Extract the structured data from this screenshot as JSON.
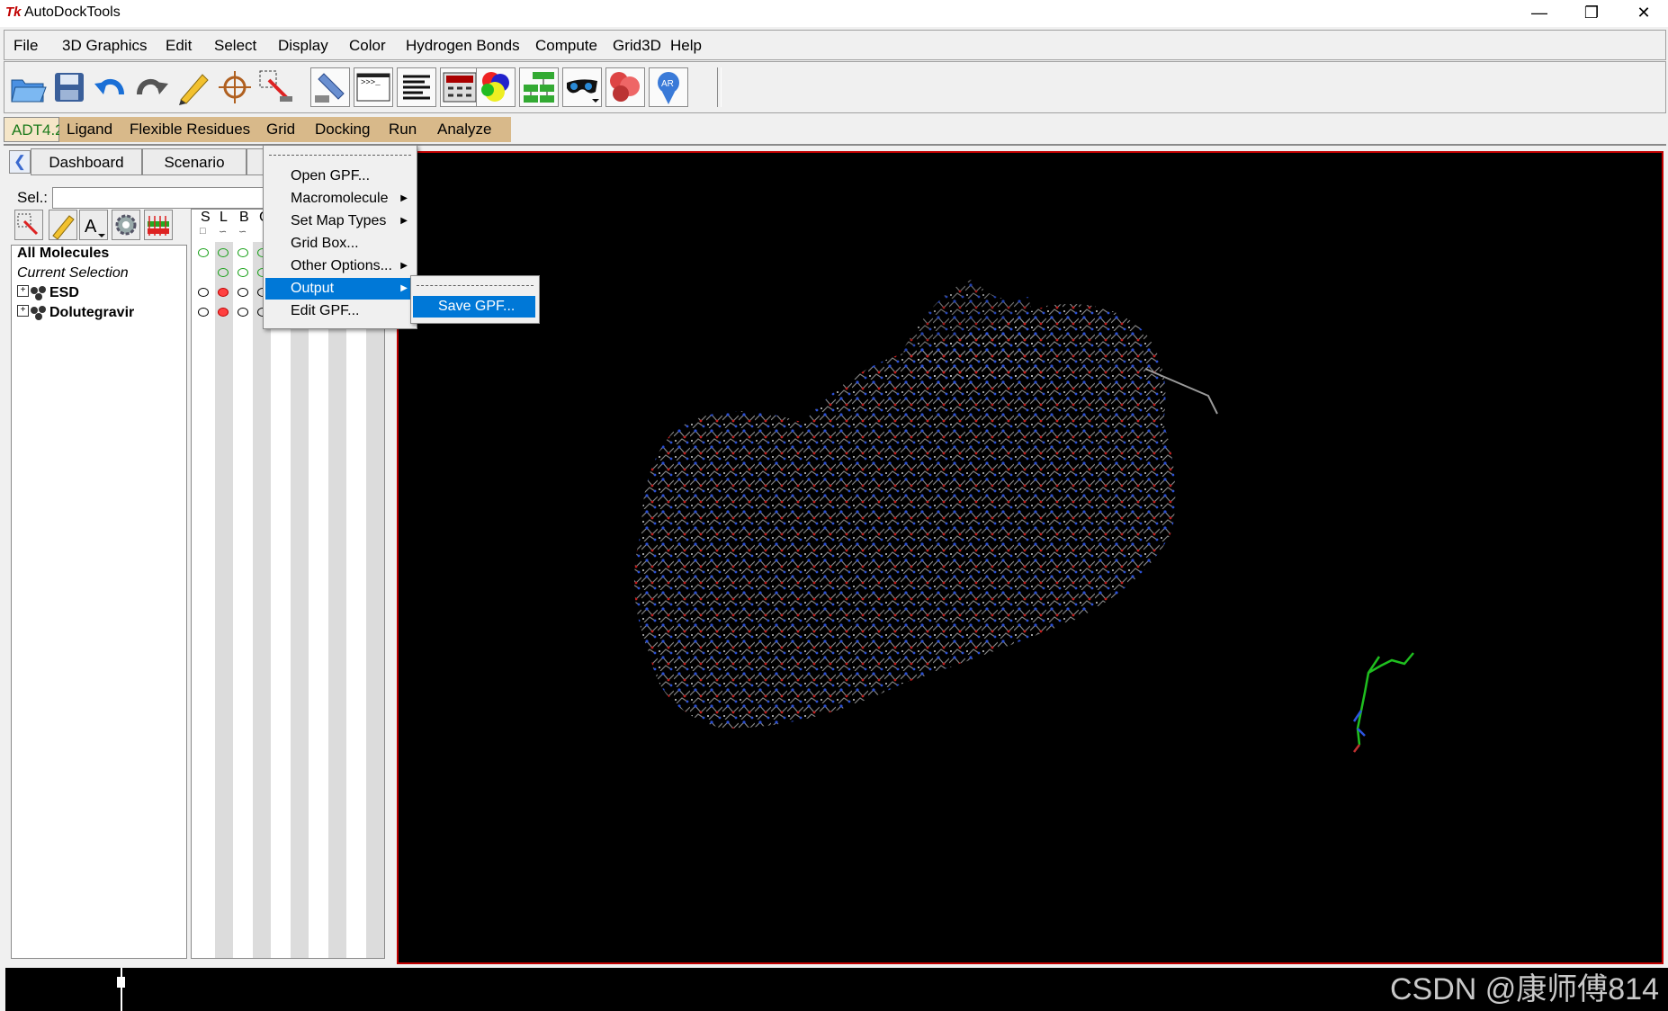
{
  "window": {
    "title": "AutoDockTools",
    "icon": "tk-icon",
    "controls": [
      "minimize-icon",
      "restore-icon",
      "close-icon"
    ]
  },
  "menubar": [
    "File",
    "3D Graphics",
    "Edit",
    "Select",
    "Display",
    "Color",
    "Hydrogen Bonds",
    "Compute",
    "Grid3D",
    "Help"
  ],
  "toolbar_icons": [
    "open-folder-icon",
    "save-icon",
    "undo-icon",
    "redo-icon",
    "pencil-icon",
    "crosshair-icon",
    "pick-icon",
    "hand-icon",
    "python-shell-icon",
    "text-lines-icon",
    "dashboard-icon",
    "color-spheres-icon",
    "tree-network-icon",
    "stereo-glasses-icon",
    "molecule-surface-icon",
    "ar-vision-icon"
  ],
  "adt_tabs": [
    "ADT4.2",
    "Ligand",
    "Flexible Residues",
    "Grid",
    "Docking",
    "Run",
    "Analyze"
  ],
  "left_panel": {
    "tabs": [
      "Dashboard",
      "Scenario"
    ],
    "sel_label": "Sel.:",
    "sel_value": "",
    "column_headers": [
      "S",
      "L",
      "B",
      "C"
    ],
    "tree": [
      {
        "label": "All Molecules",
        "style": "bold"
      },
      {
        "label": "Current Selection",
        "style": "italic"
      },
      {
        "label": "ESD",
        "style": "bold"
      },
      {
        "label": "Dolutegravir",
        "style": "bold"
      }
    ]
  },
  "grid_menu": {
    "items": [
      "Open GPF...",
      "Macromolecule",
      "Set Map Types",
      "Grid Box...",
      "Other Options...",
      "Output",
      "Edit GPF..."
    ],
    "has_submenu": [
      false,
      true,
      true,
      false,
      true,
      true,
      false
    ],
    "active": "Output"
  },
  "output_submenu": {
    "items": [
      "Save GPF..."
    ],
    "active": "Save GPF..."
  },
  "colors": {
    "menu_highlight": "#0078d7",
    "adt_tab": "#d8b98a",
    "viewer_border": "#c00000",
    "viewer_bg": "#000000"
  },
  "watermark": "CSDN @康师傅814"
}
